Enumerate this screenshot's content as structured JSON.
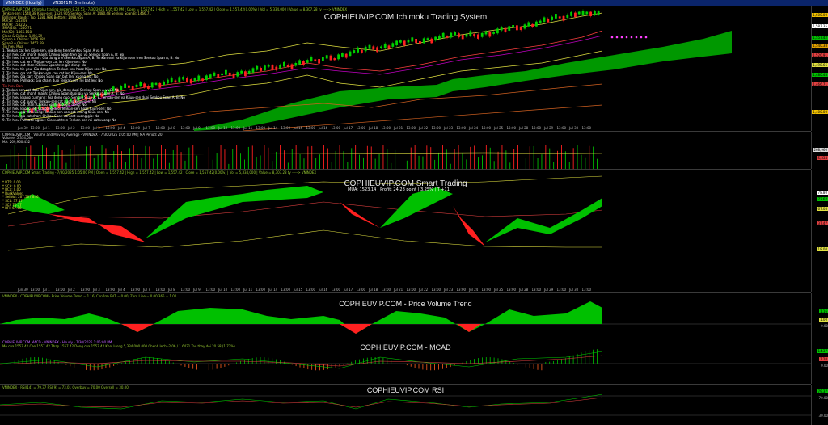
{
  "window": {
    "tab_active": "VNINDEX (Hourly)",
    "tab_other": "VN30F1M (5-minute)"
  },
  "panes": {
    "ichimoku": {
      "title": "COPHIEUVIP.COM Ichimoku Trading System",
      "header": "COPHIEUVIP.COM Ichimoku trading system 8.24.53 - 7/30/2025 1:05:00 PM | Open = 1,557.42 | High = 1,557.42 | Low = 1,557.42 | Close = 1,557.42(0.00%) | Vol = 5,334,000 | Value = 8,307.28 ty -----> VNINDEX",
      "legend_top": [
        "Tenkan-sen: 1540.38  Kijun-sen: 1520.905  Senkou Span A: 1480.48  Senkou Span B: 1466.71",
        "Bollinger Bands: Top: 1581.986  Bottom: 1498.656",
        "MA(5): 1543.08",
        "MA(9): 1542.22",
        "SMA(20): 1540.71",
        "MA(50): 1466.158",
        "Close & Chikou: 1496.29",
        "Spanh A Chikou: 1456.382",
        "SpanB A Chikou: 1452.69",
        "Tin hieu Mua"
      ],
      "buy_signals": [
        "1. Tenkan cat len Kijun-sen, gia dong tren Senkou Span A va B",
        "2. Tin hieu cat nhanh manh: Chikou Span tren gia va Senkou Span A, B: No",
        "3. Tin hieu ho tro manh: Gia dong tren Senkou Span A, B. Tenkan-sen va Kijun-sen tren Senkou Span A, B: No",
        "4. Tin hieu cat len: Tenkan-sen cat len Kijun-sen: No",
        "5. Tin hieu cat chan: Chikou Span tren gia dong: No",
        "6. Tin hieu tin yeu: Gia dong tren Tenkan-sen hoac Kijun-sen: No",
        "7. Tin hieu gia tot: Tenkan-sen can cat len Kijun-sen: No",
        "8. Tin hieu gia can: Chikou Span can bat len, xuong gia: No",
        "9. Tin hieu Pullback: Gia cham duoi Tenkan-sen roi bat len: No"
      ],
      "sell_label": "Tin hieu Ban",
      "sell_signals": [
        "1. Tenkan-sen cat duoi Kijun-sen, gia dong duoi Senkou Span A va B: No",
        "2. Tin hieu cat nhanh manh: Chikou Span duoi gia va Senkou Span A, B: No",
        "3. Tin hieu khang cu manh: Gia dong duoi Senkou Span A, B. Tenkan-sen va Kijun-sen duoi Senkou Span A, B: No",
        "4. Tin hieu cat xuong: Tenkan-sen cat xuong Kijun-sen: No",
        "5. Tin hieu cat chan: Chikou Span duoi gia dong: No",
        "6. Tin hieu khong tot: Gia dong duoi Tenkan-sen hoac Kijun-sen: No",
        "7. Tin hieu gia cat xuong: Tenkan-sen can cat xuong Kijun-sen: No",
        "8. Tin hieu gia cat chan: Chikou Span can cat xuong gia: No",
        "9. Tin hieu Pullback nguoc: Gia vuot tren Tenkan-sen roi cat xuong: No"
      ],
      "price_labels": [
        {
          "text": "1,600.00",
          "color": "#f0c000"
        },
        {
          "text": "1,587.35",
          "color": "#ffffff"
        },
        {
          "text": "1,557.42",
          "color": "#00c000"
        },
        {
          "text": "1,540.38",
          "color": "#e0a000"
        },
        {
          "text": "1,520.91",
          "color": "#e04040"
        },
        {
          "text": "1,498.66",
          "color": "#e0e040"
        },
        {
          "text": "1,480.48",
          "color": "#00c000"
        },
        {
          "text": "1,466.71",
          "color": "#e04040"
        },
        {
          "text": "1,400.00",
          "color": "#f0c000"
        }
      ]
    },
    "volume": {
      "header": "COPHIEUVIP.COM - Volume and Moving Average - VNINDEX - 7/30/2025 1:05:00 PM | MA Period: 20",
      "legend": [
        "Volume: 5,334,000",
        "MA: 269,960,432"
      ],
      "labels": [
        "268,960",
        "5,334"
      ]
    },
    "smart": {
      "title": "COPHIEUVIP.COM Smart Trading",
      "header": "COPHIEUVIP.COM Smart Trading - 7/30/2025 1:05:00 PM | Open = 1,557.42 | High = 1,557.42 | Low = 1,557.42 | Close = 1,557.42(0.00%) | Vol = 5,334,000 | Value = 8,307.28 ty -----> VNINDEX",
      "annotation": "MUA: 1523.14 | Profit: 24.28 point | 3.25% | T +11",
      "legend": [
        "* BTS: 0.00",
        "* SCA: 0.00",
        "* BCa: 0.00",
        "* BuskValue:",
        "* SellVol: 267,567,846",
        "* SCL: 37.47",
        "* SCI: 70.37",
        "* BFI: 67.08"
      ],
      "labels": [
        {
          "text": "78.80",
          "color": "#ffffff"
        },
        {
          "text": "72.62",
          "color": "#00c000"
        },
        {
          "text": "67.08",
          "color": "#e0e040"
        },
        {
          "text": "37.47",
          "color": "#e04040"
        },
        {
          "text": "18.00",
          "color": "#e0e040"
        }
      ]
    },
    "pvt": {
      "title": "COPHIEUVIP.COM - Price Volume Trend",
      "header": "VNINDEX - COPHIEUVIP.COM - Price Volume Trend = 1.16, Confirm PVT = 0.00, Zero Line = 0.00,365 = 1.00",
      "labels": [
        "1.16",
        "1.00",
        "0.00"
      ]
    },
    "macd": {
      "title": "COPHIEUVIP.COM - MCAD",
      "header": "COPHIEUVIP.COM MACD - VNINDEX - Hourly - 7/30/2025 1:05:00 PM",
      "subheader": "Mo cua 1557.42  Cao 1557.42  Thap 1557.42  Dong cua 1557.42  Khoi luong 5,334,000.000  Chenh lech -2.06 / 1.6421  Tao thay doi 20.58 (1.72%)",
      "labels": [
        "14.37",
        "7.20",
        "0.00"
      ]
    },
    "rsi": {
      "title": "COPHIEUVIP.COM RSI",
      "header": "VNINDEX - RSI(14) = 79.37  RSI(9) = 73.01  Overbuy = 70.00  Oversell = 30.00",
      "labels": [
        "79.37",
        "70.00",
        "30.00"
      ]
    },
    "dates": [
      "Jun 30",
      "13:00",
      "Jul 1",
      "13:00",
      "Jul 2",
      "13:00",
      "Jul 3",
      "13:00",
      "Jul 4",
      "13:00",
      "Jul 7",
      "13:00",
      "Jul 8",
      "13:00",
      "Jul 9",
      "13:00",
      "Jul 10",
      "13:00",
      "Jul 11",
      "13:00",
      "Jul 14",
      "13:00",
      "Jul 15",
      "13:00",
      "Jul 16",
      "13:00",
      "Jul 17",
      "13:00",
      "Jul 18",
      "13:00",
      "Jul 21",
      "13:00",
      "Jul 22",
      "13:00",
      "Jul 23",
      "13:00",
      "Jul 24",
      "13:00",
      "Jul 25",
      "13:00",
      "Jul 28",
      "13:00",
      "Jul 29",
      "13:00",
      "Jul 30",
      "13:00"
    ],
    "colors": {
      "up": "#00d000",
      "down": "#ff2020",
      "cloud": "#00a000",
      "tenkan": "#ff4040",
      "kijun": "#c000c0"
    }
  }
}
